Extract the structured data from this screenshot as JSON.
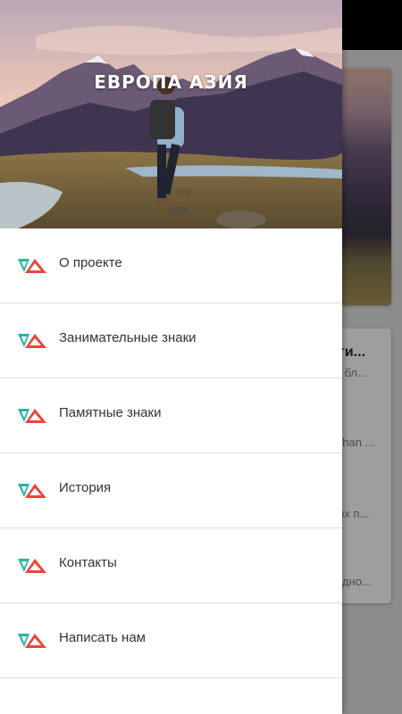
{
  "header": {
    "brand_text": "ЕВРОПА АЗИЯ"
  },
  "menu": {
    "items": [
      {
        "label": "О проекте",
        "icon": "ea-logo-icon"
      },
      {
        "label": "Занимательные знаки",
        "icon": "ea-logo-icon"
      },
      {
        "label": "Памятные знаки",
        "icon": "ea-logo-icon"
      },
      {
        "label": "История",
        "icon": "ea-logo-icon"
      },
      {
        "label": "Контакты",
        "icon": "ea-logo-icon"
      },
      {
        "label": "Написать нам",
        "icon": "ea-logo-icon"
      }
    ]
  },
  "background": {
    "card_title": "ти...",
    "snippets": [
      "з бл...",
      "ohan ...",
      "ых п...",
      "одно..."
    ]
  },
  "colors": {
    "logo_teal": "#2bb3a5",
    "logo_red": "#e8463a",
    "scrim": "rgba(0,0,0,0.35)"
  }
}
